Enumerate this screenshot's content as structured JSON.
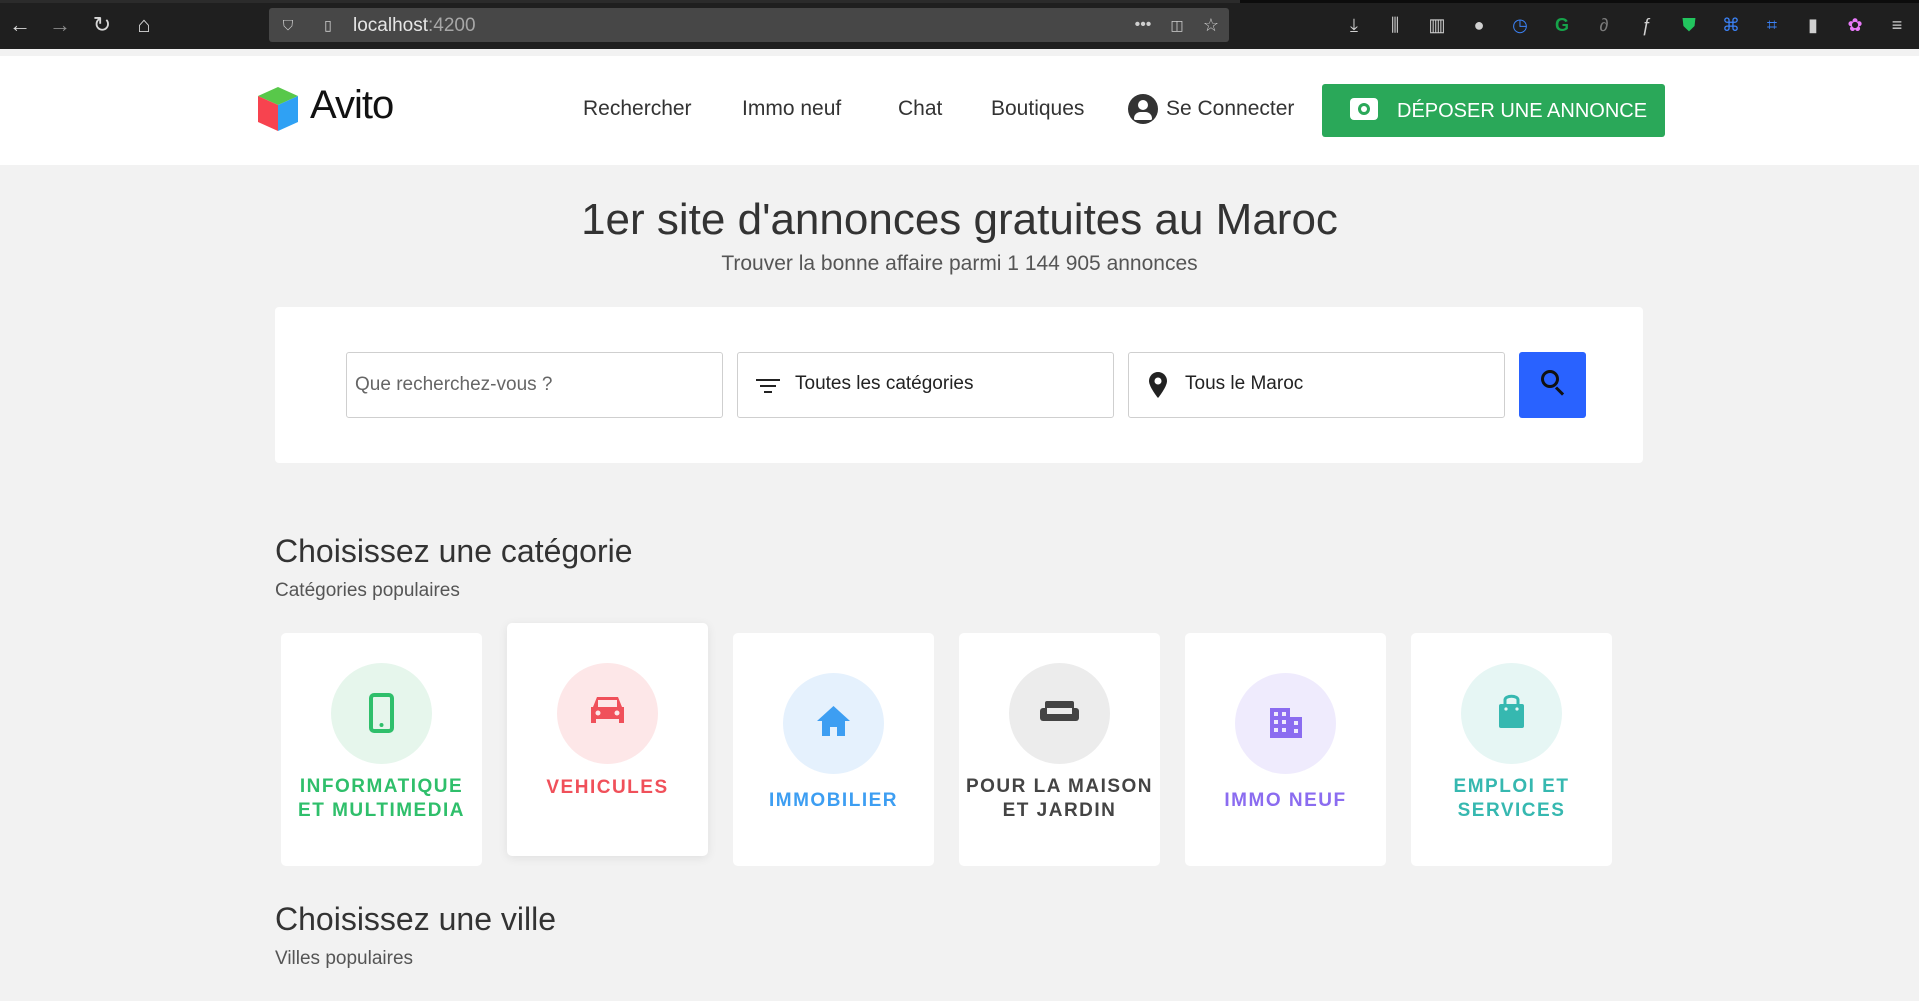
{
  "browser": {
    "url_host": "localhost",
    "url_port": ":4200"
  },
  "header": {
    "logo_text": "Avito",
    "nav": [
      "Rechercher",
      "Immo neuf",
      "Chat",
      "Boutiques"
    ],
    "connect_label": "Se Connecter",
    "cta_label": "DÉPOSER UNE ANNONCE"
  },
  "hero": {
    "title": "1er site d'annonces gratuites au Maroc",
    "subtitle": "Trouver la bonne affaire parmi 1 144 905 annonces"
  },
  "search": {
    "query_placeholder": "Que recherchez-vous ?",
    "category_value": "Toutes les catégories",
    "location_value": "Tous le Maroc"
  },
  "categories_section": {
    "title": "Choisissez une catégorie",
    "subtitle": "Catégories populaires",
    "items": [
      {
        "line1": "INFORMATIQUE",
        "line2": "ET MULTIMEDIA",
        "icon": "smartphone-icon",
        "color": "#2fbf6b",
        "bg": "#e6f6ec"
      },
      {
        "line1": "VEHICULES",
        "line2": "",
        "icon": "car-icon",
        "color": "#f0505a",
        "bg": "#fde7e8"
      },
      {
        "line1": "IMMOBILIER",
        "line2": "",
        "icon": "home-icon",
        "color": "#3d9ef2",
        "bg": "#e5f1fd"
      },
      {
        "line1": "POUR LA MAISON",
        "line2": "ET JARDIN",
        "icon": "sofa-icon",
        "color": "#444444",
        "bg": "#ececec"
      },
      {
        "line1": "IMMO NEUF",
        "line2": "",
        "icon": "building-icon",
        "color": "#8b6cf0",
        "bg": "#efebfd"
      },
      {
        "line1": "EMPLOI ET",
        "line2": "SERVICES",
        "icon": "bag-icon",
        "color": "#36b8b0",
        "bg": "#e6f6f4"
      }
    ]
  },
  "cities_section": {
    "title": "Choisissez une ville",
    "subtitle": "Villes populaires"
  }
}
